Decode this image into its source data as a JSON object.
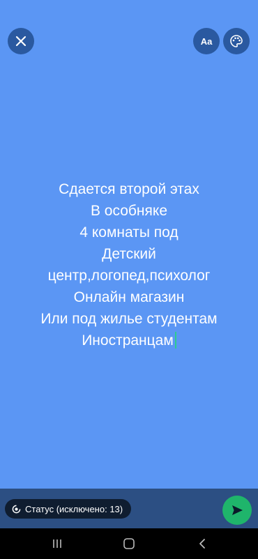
{
  "toolbar": {
    "font_button_label": "Aa"
  },
  "status": {
    "lines": [
      "Сдается второй этах",
      "В особняке",
      "4 комнаты под",
      "Детский",
      "центр,логопед,психолог",
      "Онлайн магазин",
      "Или под жилье студентам",
      "Иностранцам"
    ]
  },
  "footer": {
    "audience_label": "Статус (исключено: 13)"
  },
  "colors": {
    "background": "#5b96f4",
    "send_button": "#1fb56b",
    "cursor": "#2ecc8f"
  },
  "icons": {
    "close": "close-icon",
    "palette": "palette-icon",
    "audience": "status-ring-icon",
    "send": "send-icon",
    "nav_recent": "recent-apps-icon",
    "nav_home": "home-icon",
    "nav_back": "back-icon"
  }
}
